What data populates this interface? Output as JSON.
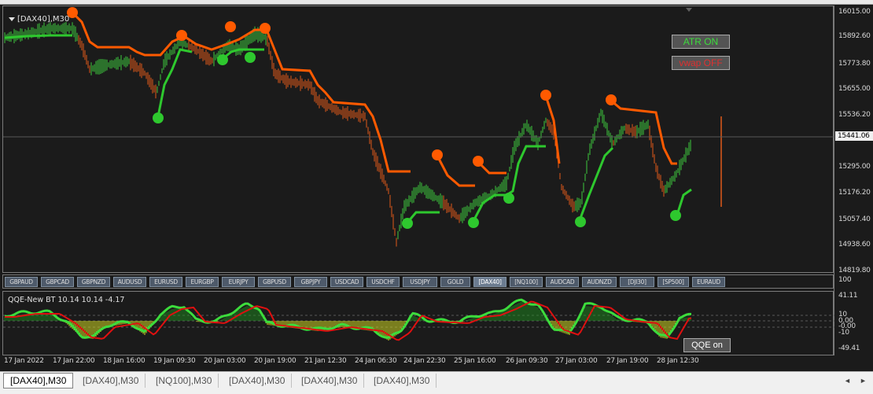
{
  "chart": {
    "title": "[DAX40],M30",
    "indicator_buttons": [
      {
        "label": "ATR ON",
        "color": "#3cdc3c"
      },
      {
        "label": "vwap OFF",
        "color": "#e03030"
      }
    ]
  },
  "price_axis": {
    "labels": [
      "16015.00",
      "15892.60",
      "15773.80",
      "15655.00",
      "15536.20",
      "15441.06",
      "15295.00",
      "15176.20",
      "15057.40",
      "14938.60",
      "14819.80"
    ],
    "current_price": "15441.06"
  },
  "symbols": [
    {
      "label": "GBPAUD",
      "active": false
    },
    {
      "label": "GBPCAD",
      "active": false
    },
    {
      "label": "GBPNZD",
      "active": false
    },
    {
      "label": "AUDUSD",
      "active": false
    },
    {
      "label": "EURUSD",
      "active": false
    },
    {
      "label": "EURGBP",
      "active": false
    },
    {
      "label": "EURJPY",
      "active": false
    },
    {
      "label": "GBPUSD",
      "active": false
    },
    {
      "label": "GBPJPY",
      "active": false
    },
    {
      "label": "USDCAD",
      "active": false
    },
    {
      "label": "USDCHF",
      "active": false
    },
    {
      "label": "USDJPY",
      "active": false
    },
    {
      "label": "GOLD",
      "active": false
    },
    {
      "label": "[DAX40]",
      "active": true
    },
    {
      "label": "[NQ100]",
      "active": false
    },
    {
      "label": "AUDCAD",
      "active": false
    },
    {
      "label": "AUDNZD",
      "active": false
    },
    {
      "label": "[DJI30]",
      "active": false
    },
    {
      "label": "[SP500]",
      "active": false
    },
    {
      "label": "EURAUD",
      "active": false
    }
  ],
  "sub_chart": {
    "title": "QQE-New BT 10.14 10.14 -4.17",
    "axis_labels": [
      "100",
      "41.11",
      "10",
      "0.00",
      "-0.00",
      "-10",
      "-49.41"
    ],
    "button_label": "QQE on"
  },
  "time_axis": [
    "17 Jan 2022",
    "17 Jan 22:00",
    "18 Jan 16:00",
    "19 Jan 09:30",
    "20 Jan 03:00",
    "20 Jan 19:00",
    "21 Jan 12:30",
    "24 Jan 06:30",
    "24 Jan 22:30",
    "25 Jan 16:00",
    "26 Jan 09:30",
    "27 Jan 03:00",
    "27 Jan 19:00",
    "28 Jan 12:30"
  ],
  "tabs": [
    {
      "label": "[DAX40],M30",
      "active": true
    },
    {
      "label": "[DAX40],M30",
      "active": false
    },
    {
      "label": "[NQ100],M30",
      "active": false
    },
    {
      "label": "[DAX40],M30",
      "active": false
    },
    {
      "label": "[DAX40],M30",
      "active": false
    },
    {
      "label": "[DAX40],M30",
      "active": false
    }
  ],
  "tab_nav": [
    "◄",
    "►"
  ],
  "colors": {
    "bull": "#3cc83c",
    "bear": "#e05a1a",
    "stop_line": "#ff5a00",
    "dot_red": "#ff5a00",
    "dot_green": "#2ec82e"
  }
}
